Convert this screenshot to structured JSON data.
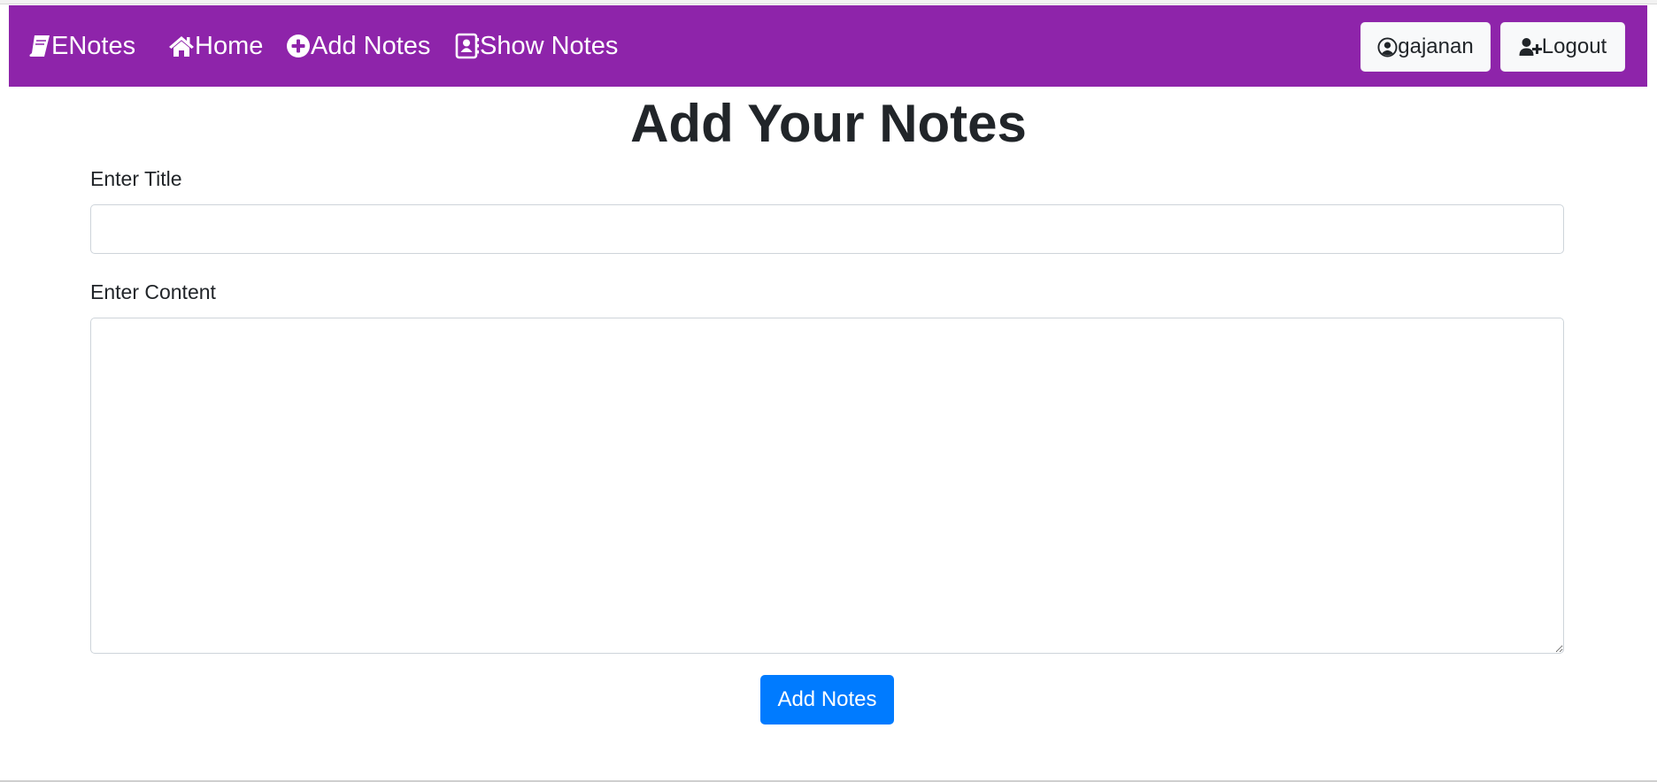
{
  "colors": {
    "navbar_bg": "#8e24aa",
    "nav_text": "#ffffff",
    "button_light": "#f8f9fa",
    "primary": "#007bff",
    "text": "#212529",
    "border": "#ced4da"
  },
  "navbar": {
    "brand": {
      "icon": "book-icon",
      "label": "ENotes"
    },
    "links": [
      {
        "icon": "home-icon",
        "label": "Home"
      },
      {
        "icon": "plus-circle-icon",
        "label": "Add Notes"
      },
      {
        "icon": "address-book-icon",
        "label": "Show Notes"
      }
    ],
    "user_button": {
      "icon": "user-circle-icon",
      "label": "gajanan"
    },
    "logout_button": {
      "icon": "user-plus-icon",
      "label": "Logout"
    }
  },
  "form": {
    "heading": "Add Your Notes",
    "title_label": "Enter Title",
    "title_value": "",
    "content_label": "Enter Content",
    "content_value": "",
    "submit_label": "Add Notes"
  }
}
